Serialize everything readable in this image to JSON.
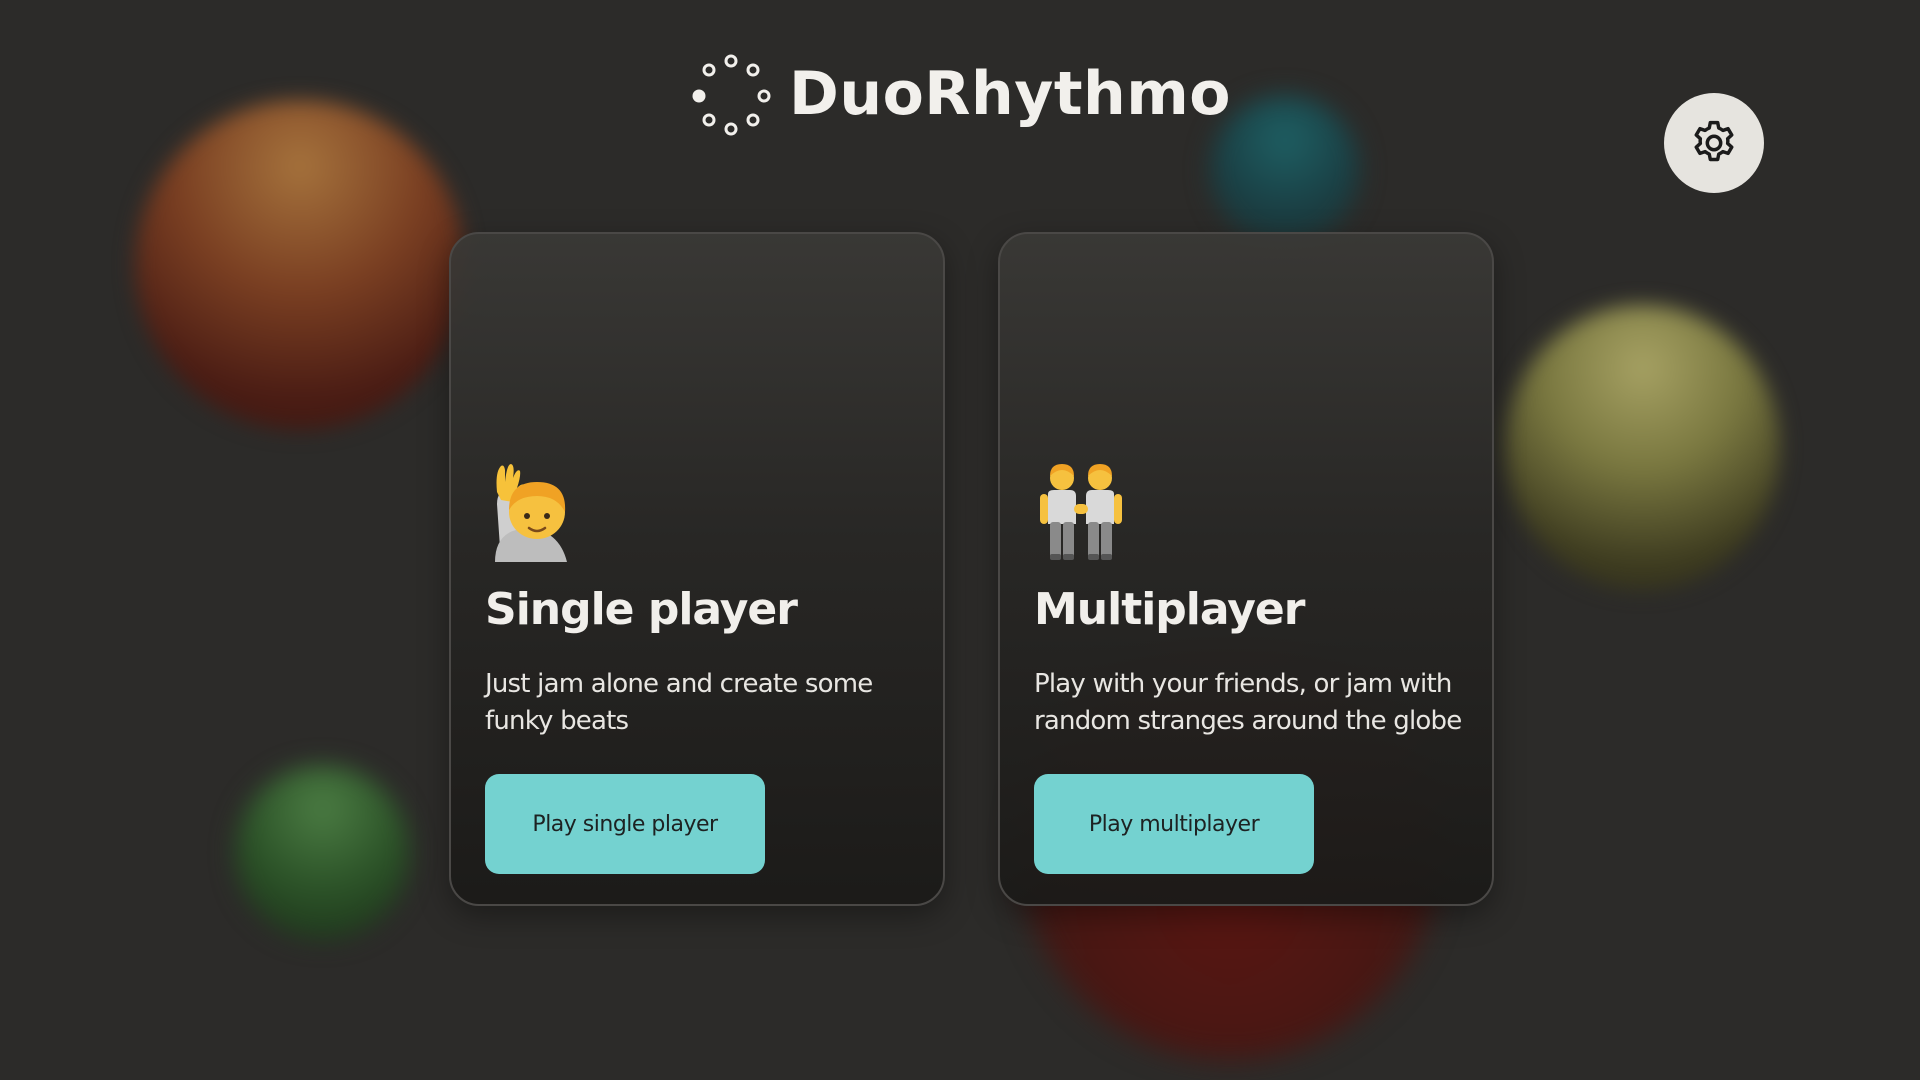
{
  "app": {
    "title": "DuoRhythmo"
  },
  "header": {
    "logo_icon": "dotted-circle-logo-icon",
    "settings_icon": "gear-icon"
  },
  "modes": [
    {
      "emoji_icon": "person-raising-hand-icon",
      "title": "Single player",
      "description": "Just jam alone and create some funky beats",
      "button_label": "Play single player"
    },
    {
      "emoji_icon": "two-people-holding-hands-icon",
      "title": "Multiplayer",
      "description": "Play with your friends, or jam with random stranges around the globe",
      "button_label": "Play multiplayer"
    }
  ],
  "colors": {
    "background": "#2c2b29",
    "accent_button": "#74d2d0",
    "settings_button": "#e6e4df",
    "text_primary": "#f1efeb"
  }
}
